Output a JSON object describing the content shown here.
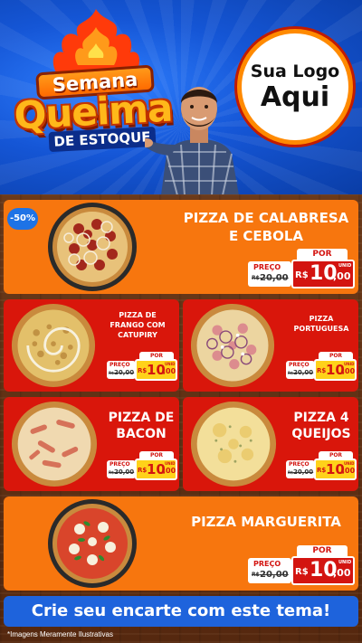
{
  "header": {
    "title_line1": "Semana",
    "title_line2": "Queima",
    "title_line3": "DE ESTOQUE",
    "logo_line1": "Sua Logo",
    "logo_line2": "Aqui"
  },
  "discount_badge": "-50%",
  "products": [
    {
      "name_line1": "PIZZA DE CALABRESA",
      "name_line2": "E CEBOLA",
      "por": "POR",
      "preco": "PREÇO",
      "old_prefix": "R$",
      "old_price": "20,00",
      "currency": "R$",
      "price_int": "10",
      "price_dec": ",00",
      "unit": "UNID"
    },
    {
      "name_line1": "PIZZA DE",
      "name_line2": "FRANGO COM",
      "name_line3": "CATUPIRY",
      "por": "POR",
      "preco": "PREÇO",
      "old_prefix": "R$",
      "old_price": "20,00",
      "currency": "R$",
      "price_int": "10",
      "price_dec": ",00",
      "unit": "UNID"
    },
    {
      "name_line1": "PIZZA",
      "name_line2": "PORTUGUESA",
      "por": "POR",
      "preco": "PREÇO",
      "old_prefix": "R$",
      "old_price": "20,00",
      "currency": "R$",
      "price_int": "10",
      "price_dec": ",00",
      "unit": "UNID"
    },
    {
      "name_line1": "PIZZA DE",
      "name_line2": "BACON",
      "por": "POR",
      "preco": "PREÇO",
      "old_prefix": "R$",
      "old_price": "20,00",
      "currency": "R$",
      "price_int": "10",
      "price_dec": ",00",
      "unit": "UNID"
    },
    {
      "name_line1": "PIZZA 4",
      "name_line2": "QUEIJOS",
      "por": "POR",
      "preco": "PREÇO",
      "old_prefix": "R$",
      "old_price": "20,00",
      "currency": "R$",
      "price_int": "10",
      "price_dec": ",00",
      "unit": "UNID"
    },
    {
      "name_line1": "PIZZA MARGUERITA",
      "por": "POR",
      "preco": "PREÇO",
      "old_prefix": "R$",
      "old_price": "20,00",
      "currency": "R$",
      "price_int": "10",
      "price_dec": ",00",
      "unit": "UNID"
    }
  ],
  "cta_text": "Crie seu encarte com este tema!",
  "disclaimer": "*Imagens Meramente Ilustrativas",
  "colors": {
    "orange_card": "#f7760e",
    "red_card": "#d9160b",
    "blue": "#1e63dc",
    "price_red": "#d31410",
    "price_yellow": "#ffd21a"
  }
}
